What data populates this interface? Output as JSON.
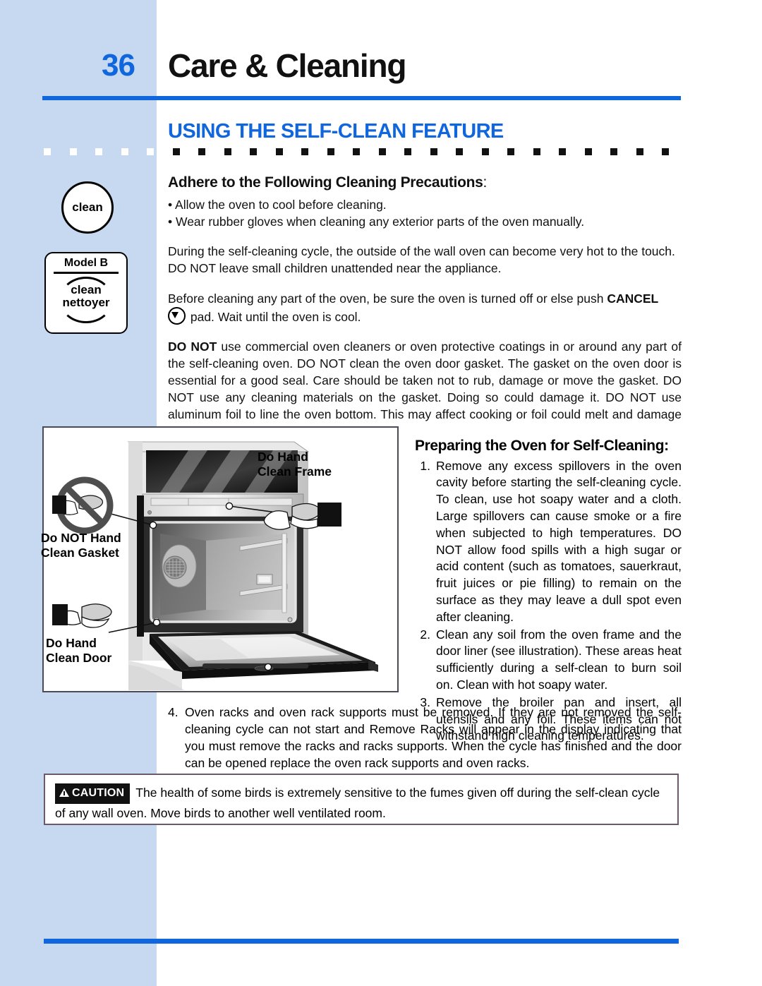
{
  "page": {
    "number": "36",
    "chapter_title": "Care & Cleaning",
    "section_heading": "USING THE SELF-CLEAN FEATURE",
    "accent_blue": "#1066dd",
    "sidebar_blue": "#c6d9f1"
  },
  "sidebar": {
    "clean_circle_label": "clean",
    "model_box": {
      "model_label": "Model B",
      "line1": "clean",
      "line2": "nettoyer"
    }
  },
  "precautions": {
    "heading": "Adhere to the Following Cleaning Precautions",
    "heading_colon": ":",
    "bullets": [
      "• Allow the oven to cool before cleaning.",
      "• Wear rubber gloves when cleaning any exterior parts of the oven manually."
    ],
    "para_children": "During the self-cleaning cycle, the outside of the wall oven can become very hot to the touch. DO NOT leave small children unattended near the appliance.",
    "para_cancel_pre": "Before cleaning any part of the oven, be sure the oven is turned off or else push ",
    "para_cancel_bold": "CANCEL",
    "para_cancel_post": " pad. Wait until the oven is cool.",
    "para_donot_bold": "DO NOT",
    "para_donot_rest": " use commercial oven cleaners or oven protective coatings in or around any part of the self-cleaning oven. DO NOT clean the oven door gasket. The gasket on the oven door is essential for a good seal. Care should be taken not to rub, damage or move the gasket. DO NOT use any cleaning materials on the gasket. Doing so could damage it. DO NOT use aluminum foil to line the oven bottom. This may affect cooking or foil could melt and damage the oven surface."
  },
  "illustration": {
    "label_frame": "Do Hand\nClean  Frame",
    "label_gasket": "Do NOT Hand\nClean Gasket",
    "label_door": "Do Hand\nClean Door"
  },
  "preparing": {
    "heading": "Preparing the Oven for Self-Cleaning:",
    "items": [
      {
        "number": "1.",
        "text": "Remove any excess spillovers in the oven cavity before starting the self-cleaning cycle. To clean, use hot soapy water and a cloth. Large spillovers can cause smoke or a fire when subjected to high temperatures. DO NOT allow food spills with a high sugar or acid content (such as tomatoes, sauerkraut, fruit juices or pie filling) to remain on the surface as they may leave a dull spot even after cleaning."
      },
      {
        "number": "2.",
        "text": "Clean any soil from the oven frame and the door liner (see illustration). These areas heat sufficiently during a self-clean to burn soil on. Clean with hot soapy water."
      },
      {
        "number": "3.",
        "text": "Remove the broiler pan and insert, all utensils and any foil. These items can not withstand high cleaning temperatures."
      }
    ],
    "item4": {
      "number": "4.",
      "text": "Oven racks and oven rack supports must be removed. If they are not removed the self-cleaning cycle can not start and Remove Racks  will appear in the display indicating that you must remove the racks and racks supports. When the cycle has finished and the door can be opened replace the oven rack supports and oven racks."
    }
  },
  "caution": {
    "badge_label": "CAUTION",
    "text": "The health of some birds is extremely sensitive to the fumes given off during the self-clean cycle of any wall oven. Move birds to another well ventilated room."
  }
}
